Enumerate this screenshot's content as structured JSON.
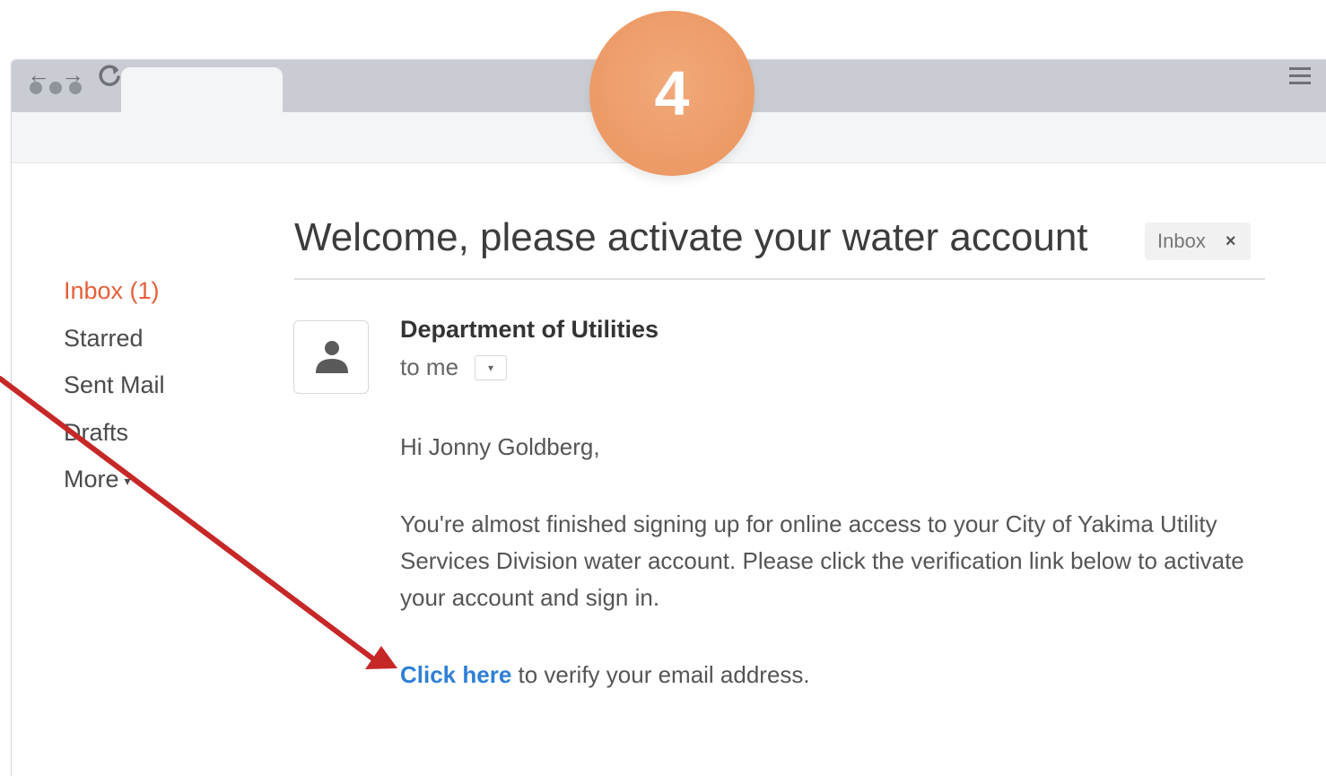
{
  "step": {
    "number": "4",
    "color": "#ec9a66"
  },
  "browser": {
    "window_dots": [
      "dot",
      "dot",
      "dot"
    ],
    "nav": {
      "back": "←",
      "forward": "→",
      "reload": "C"
    }
  },
  "sidebar": {
    "items": [
      {
        "label": "Inbox (1)",
        "active": true
      },
      {
        "label": "Starred",
        "active": false
      },
      {
        "label": "Sent Mail",
        "active": false
      },
      {
        "label": "Drafts",
        "active": false
      },
      {
        "label": "More",
        "active": false
      }
    ],
    "active_color": "#e4603a"
  },
  "message": {
    "subject": "Welcome, please activate your water account",
    "label": "Inbox",
    "label_close": "×",
    "sender": "Department of Utilities",
    "to": "to me",
    "greeting": "Hi Jonny Goldberg,",
    "body": "You're almost finished signing up for online access to your City of Yakima Utility Services Division water account. Please click the verification link below to activate your account and sign in.",
    "link_text": "Click here",
    "link_suffix": " to verify your email address.",
    "link_color": "#2f7fd6"
  },
  "annotation": {
    "arrow_color": "#c62828",
    "arrow_target": "verification-link"
  }
}
